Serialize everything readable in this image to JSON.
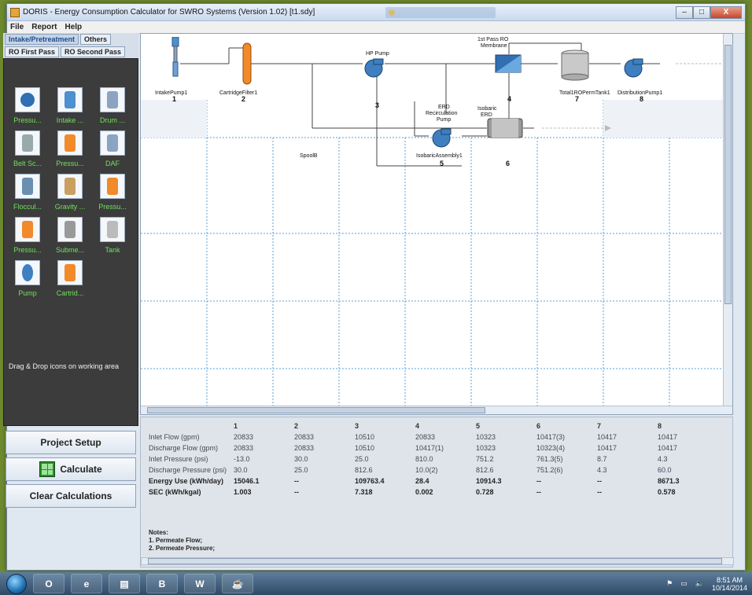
{
  "window": {
    "title": "DORIS - Energy Consumption Calculator for SWRO Systems (Version 1.02)  [t1.sdy]",
    "background_tab": "",
    "buttons": {
      "minimize": "–",
      "maximize": "□",
      "close": "X"
    }
  },
  "menu": [
    "File",
    "Report",
    "Help"
  ],
  "tabs": {
    "row1": [
      "Intake/Pretreatment",
      "Others"
    ],
    "row2": [
      "RO First Pass",
      "RO Second Pass"
    ]
  },
  "palette": {
    "items": [
      {
        "label": "Pressu...",
        "icon": "pressure-filter-icon"
      },
      {
        "label": "Intake ...",
        "icon": "intake-pump-icon"
      },
      {
        "label": "Drum ...",
        "icon": "drum-screen-icon"
      },
      {
        "label": "Belt Sc...",
        "icon": "belt-screen-icon"
      },
      {
        "label": "Pressu...",
        "icon": "pressure-vessel-icon"
      },
      {
        "label": "DAF",
        "icon": "daf-icon"
      },
      {
        "label": "Floccul...",
        "icon": "flocculator-icon"
      },
      {
        "label": "Gravity ...",
        "icon": "gravity-filter-icon"
      },
      {
        "label": "Pressu...",
        "icon": "pressure-tank-icon"
      },
      {
        "label": "Pressu...",
        "icon": "pressure-column-icon"
      },
      {
        "label": "Subme...",
        "icon": "submerged-membrane-icon"
      },
      {
        "label": "Tank",
        "icon": "tank-icon"
      },
      {
        "label": "Pump",
        "icon": "pump-icon"
      },
      {
        "label": "Cartrid...",
        "icon": "cartridge-filter-icon"
      }
    ],
    "drag_hint": "Drag & Drop icons on working area"
  },
  "actions": {
    "project_setup": "Project Setup",
    "calculate": "Calculate",
    "clear": "Clear Calculations"
  },
  "diagram": {
    "components": [
      {
        "name": "IntakePump1",
        "num": "1"
      },
      {
        "name": "CartridgeFilter1",
        "num": "2"
      },
      {
        "name": "HP Pump",
        "num": "3"
      },
      {
        "name": "1st Pass RO Membrane",
        "num": "4"
      },
      {
        "name": "IsobaricAssembly1",
        "num": "5"
      },
      {
        "name": "Isobaric ERD",
        "num": "6"
      },
      {
        "name": "Total1ROPermTank1",
        "num": "7"
      },
      {
        "name": "DistributionPump1",
        "num": "8"
      }
    ],
    "labels": {
      "hp_pump": "HP Pump",
      "ro_membrane_l1": "1st Pass RO",
      "ro_membrane_l2": "Membrane",
      "erd_recirc_l1": "ERD",
      "erd_recirc_l2": "Recirculation",
      "erd_recirc_l3": "Pump",
      "isobaric_erd_l1": "Isobaric",
      "isobaric_erd_l2": "ERD",
      "spool": "SpoolB"
    }
  },
  "results": {
    "columns": [
      "1",
      "2",
      "3",
      "4",
      "5",
      "6",
      "7",
      "8"
    ],
    "rows": [
      {
        "label": "Inlet Flow (gpm)",
        "values": [
          "20833",
          "20833",
          "10510",
          "20833",
          "10323",
          "10417(3)",
          "10417",
          "10417"
        ]
      },
      {
        "label": "Discharge Flow (gpm)",
        "values": [
          "20833",
          "20833",
          "10510",
          "10417(1)",
          "10323",
          "10323(4)",
          "10417",
          "10417"
        ]
      },
      {
        "label": "Inlet Pressure (psi)",
        "values": [
          "-13.0",
          "30.0",
          "25.0",
          "810.0",
          "751.2",
          "761.3(5)",
          "8.7",
          "4.3"
        ]
      },
      {
        "label": "Discharge Pressure (psi)",
        "values": [
          "30.0",
          "25.0",
          "812.6",
          "10.0(2)",
          "812.6",
          "751.2(6)",
          "4.3",
          "60.0"
        ]
      },
      {
        "label": "Energy Use (kWh/day)",
        "values": [
          "15046.1",
          "--",
          "109763.4",
          "28.4",
          "10914.3",
          "--",
          "--",
          "8671.3"
        ]
      },
      {
        "label": "SEC (kWh/kgal)",
        "values": [
          "1.003",
          "--",
          "7.318",
          "0.002",
          "0.728",
          "--",
          "--",
          "0.578"
        ]
      }
    ],
    "notes": [
      "Notes:",
      "1. Permeate Flow;",
      "2. Permeate Pressure;"
    ]
  },
  "taskbar": {
    "time": "8:51 AM",
    "date": "10/14/2014"
  }
}
